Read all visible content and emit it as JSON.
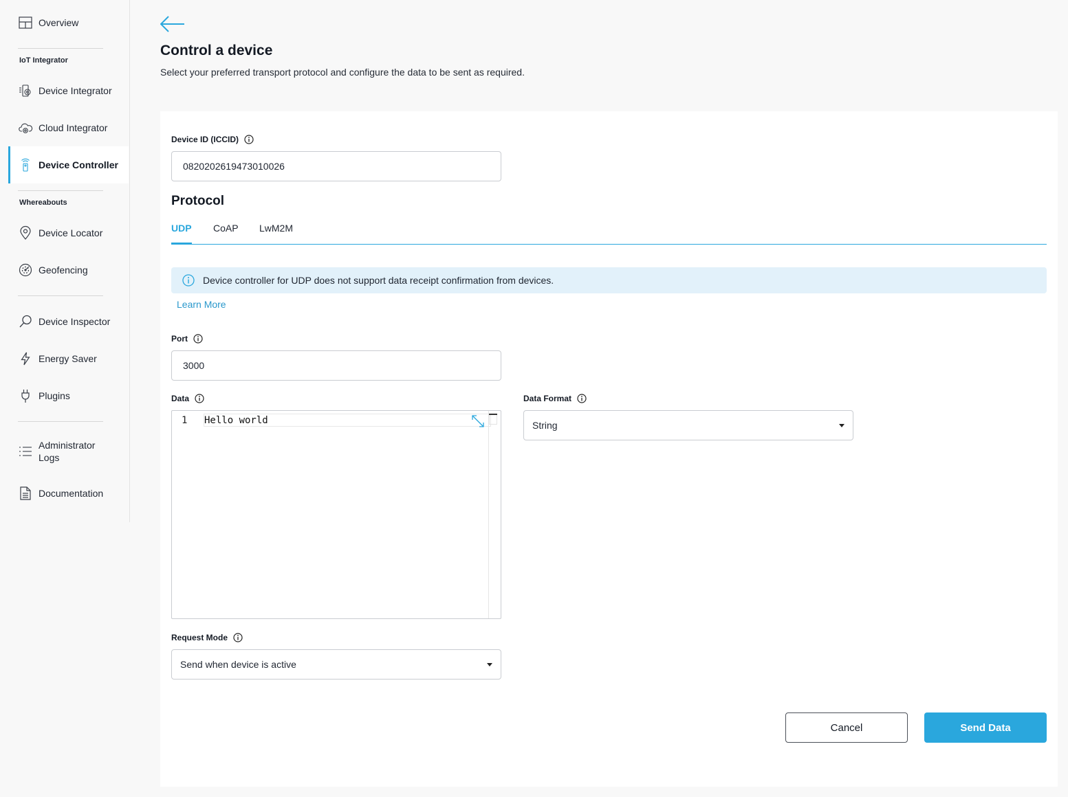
{
  "sidebar": {
    "items": [
      {
        "label": "Overview",
        "icon": "layout-icon"
      },
      {
        "label": "Device Integrator",
        "icon": "device-gear-icon"
      },
      {
        "label": "Cloud Integrator",
        "icon": "cloud-gear-icon"
      },
      {
        "label": "Device Controller",
        "icon": "remote-icon"
      },
      {
        "label": "Device Locator",
        "icon": "location-pin-icon"
      },
      {
        "label": "Geofencing",
        "icon": "radar-icon"
      },
      {
        "label": "Device Inspector",
        "icon": "magnifier-icon"
      },
      {
        "label": "Energy Saver",
        "icon": "lightning-icon"
      },
      {
        "label": "Plugins",
        "icon": "plug-icon"
      },
      {
        "label": "Administrator",
        "label2": "Logs",
        "icon": "list-icon"
      },
      {
        "label": "Documentation",
        "icon": "document-icon"
      }
    ],
    "sections": {
      "iot": "IoT Integrator",
      "whereabouts": "Whereabouts"
    },
    "active_item": "Device Controller"
  },
  "header": {
    "title": "Control a device",
    "subtitle": "Select your preferred transport protocol and configure the data to be sent as required."
  },
  "form": {
    "device_id_label": "Device ID (ICCID)",
    "device_id_value": "0820202619473010026",
    "protocol_title": "Protocol",
    "tabs": [
      {
        "label": "UDP",
        "active": true
      },
      {
        "label": "CoAP",
        "active": false
      },
      {
        "label": "LwM2M",
        "active": false
      }
    ],
    "banner_text": "Device controller for UDP does not support data receipt confirmation from devices.",
    "learn_more": "Learn More",
    "port_label": "Port",
    "port_value": "3000",
    "data_label": "Data",
    "data_line_number": "1",
    "data_value": "Hello world",
    "data_format_label": "Data Format",
    "data_format_value": "String",
    "request_mode_label": "Request Mode",
    "request_mode_value": "Send when device is active"
  },
  "actions": {
    "cancel": "Cancel",
    "send": "Send Data"
  },
  "colors": {
    "accent": "#2aa7dd",
    "banner_bg": "#e2f1fa",
    "link": "#2a98cc"
  }
}
